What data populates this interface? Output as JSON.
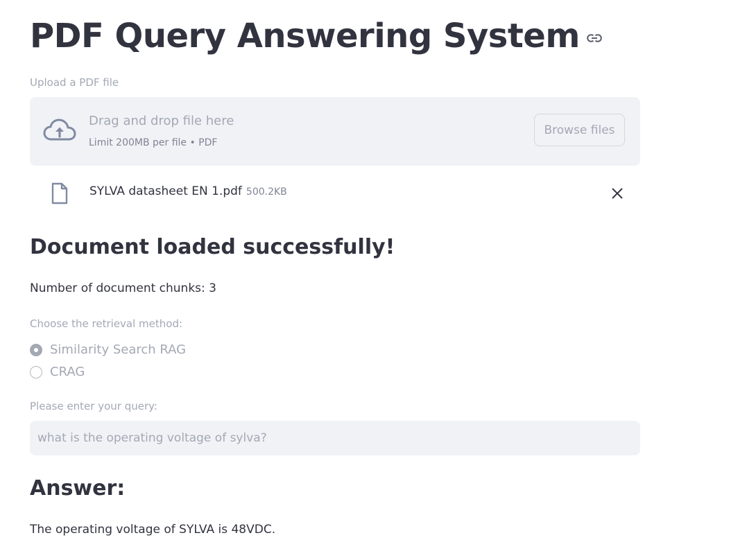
{
  "header": {
    "title": "PDF Query Answering System",
    "link_icon": "link-icon"
  },
  "uploader": {
    "label": "Upload a PDF file",
    "drop_text": "Drag and drop file here",
    "limit_text": "Limit 200MB per file • PDF",
    "browse_label": "Browse files",
    "icon": "cloud-upload-icon"
  },
  "uploaded_file": {
    "name": "SYLVA datasheet EN 1.pdf",
    "size": "500.2KB",
    "icon": "file-icon",
    "remove_icon": "close-icon"
  },
  "status": {
    "heading": "Document loaded successfully!",
    "chunks_text": "Number of document chunks: 3"
  },
  "retrieval": {
    "label": "Choose the retrieval method:",
    "options": [
      {
        "label": "Similarity Search RAG",
        "selected": true
      },
      {
        "label": "CRAG",
        "selected": false
      }
    ]
  },
  "query": {
    "label": "Please enter your query:",
    "value": "what is the operating voltage of sylva?"
  },
  "answer": {
    "heading": "Answer:",
    "text": "The operating voltage of SYLVA is 48VDC."
  },
  "colors": {
    "text": "#31333f",
    "muted": "#a3a8b4",
    "surface": "#f0f2f6"
  }
}
